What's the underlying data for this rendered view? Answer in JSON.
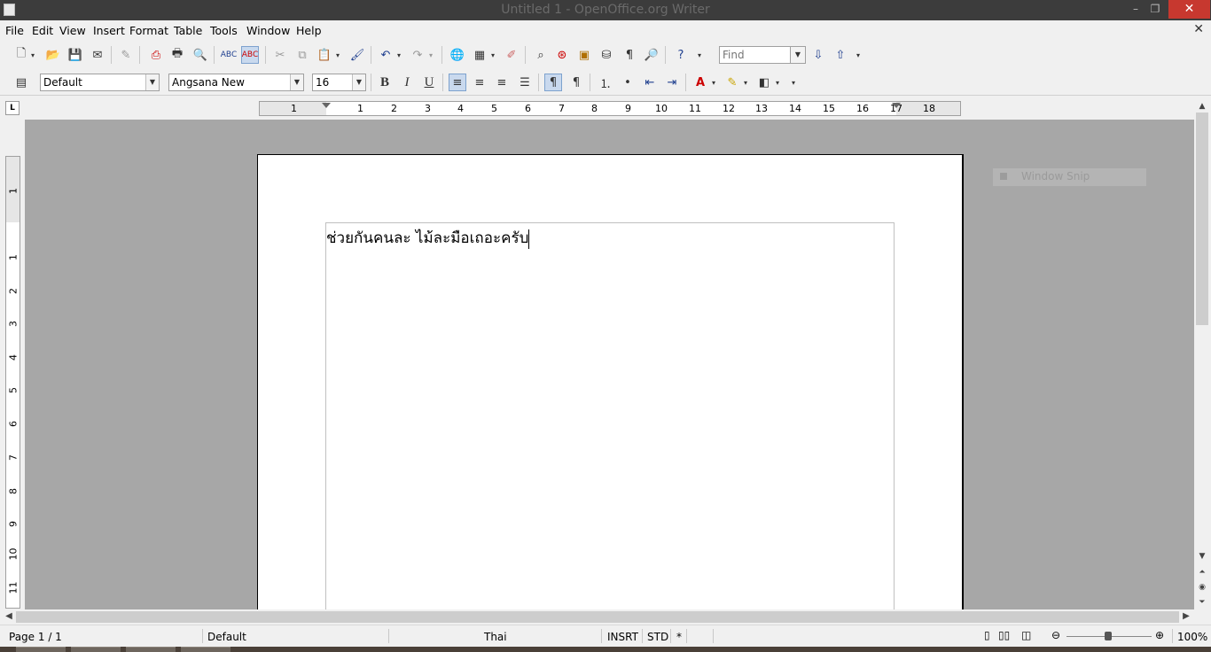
{
  "window": {
    "title": "Untitled 1 - OpenOffice.org Writer",
    "minimize_glyph": "–",
    "restore_glyph": "❐",
    "close_glyph": "✕",
    "doc_close_glyph": "✕"
  },
  "menu": [
    "File",
    "Edit",
    "View",
    "Insert",
    "Format",
    "Table",
    "Tools",
    "Window",
    "Help"
  ],
  "toolbar": {
    "find_placeholder": "Find",
    "find_value": "Find"
  },
  "formatting": {
    "paragraph_style": "Default",
    "font_name": "Angsana New",
    "font_size": "16",
    "bold_label": "B",
    "italic_label": "I",
    "underline_label": "U"
  },
  "ruler": {
    "horizontal_numbers": [
      "1",
      "1",
      "2",
      "3",
      "4",
      "5",
      "6",
      "7",
      "8",
      "9",
      "10",
      "11",
      "12",
      "13",
      "14",
      "15",
      "16",
      "17",
      "18"
    ],
    "vertical_numbers": [
      "1",
      "1",
      "2",
      "3",
      "4",
      "5",
      "6",
      "7",
      "8",
      "9",
      "10",
      "11"
    ],
    "corner_label": "L"
  },
  "document": {
    "text": "ช่วยกันคนละ ไม้ละมือเถอะครับ"
  },
  "overlay": {
    "window_snip": "Window Snip"
  },
  "status": {
    "page": "Page 1 / 1",
    "style": "Default",
    "language": "Thai",
    "insert_mode": "INSRT",
    "selection_mode": "STD",
    "modified": "*",
    "zoom": "100%"
  }
}
